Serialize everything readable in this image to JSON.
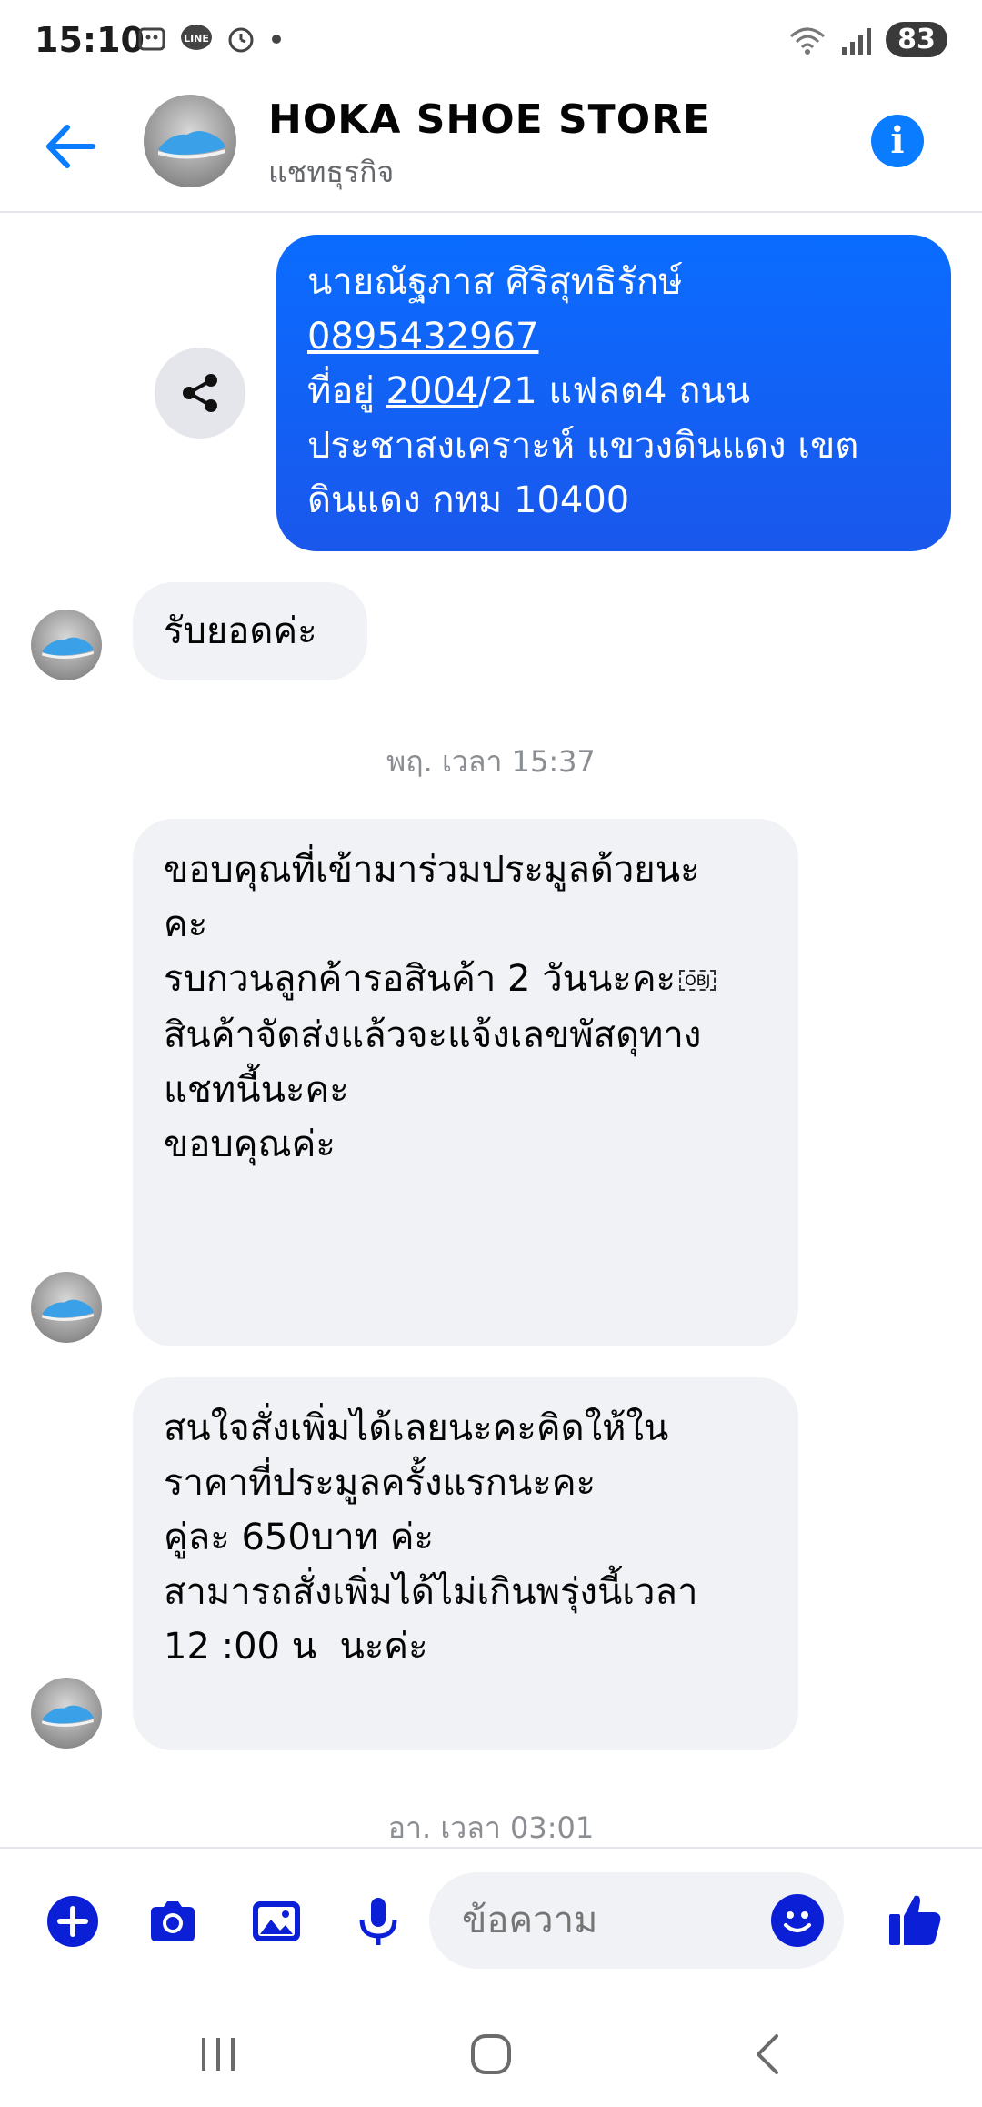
{
  "status_bar": {
    "time": "15:10",
    "icons": [
      "screenshot-icon",
      "line-icon",
      "alarm-icon",
      "dot-icon"
    ],
    "battery": "83"
  },
  "header": {
    "title": "HOKA SHOE STORE",
    "subtitle": "แชทธุรกิจ"
  },
  "messages": {
    "outgoing_1": {
      "lines": [
        "นายณัฐภาส ศิริสุทธิรักษ์",
        "0895432967",
        "ที่อยู่ ",
        "2004",
        "/21 แฟลต4 ถนน",
        "ประชาสงเคราะห์ แขวงดินแดง เขต",
        "ดินแดง กทม 10400"
      ]
    },
    "incoming_1": {
      "text": "รับยอดค่ะ"
    },
    "timestamp_1": "พฤ. เวลา 15:37",
    "incoming_2": {
      "lines": [
        "ขอบคุณที่เข้ามาร่วมประมูลด้วยนะ",
        "คะ",
        "",
        "รบกวนลูกค้ารอสินค้า 2 วันนะคะ",
        "",
        "สินค้าจัดส่งแล้วจะแจ้งเลขพัสดุทาง",
        "แชทนี้นะคะ",
        "",
        "ขอบคุณค่ะ"
      ],
      "obj_glyph": "OBJ"
    },
    "incoming_3": {
      "lines": [
        "สนใจสั่งเพิ่มได้เลยนะคะคิดให้ใน",
        "ราคาที่ประมูลครั้งแรกนะคะ",
        "คู่ละ 650บาท ค่ะ",
        "",
        "สามารถสั่งเพิ่มได้ไม่เกินพรุ่งนี้เวลา",
        "12 :00 น  นะค่ะ"
      ]
    },
    "timestamp_2": "อา. เวลา 03:01"
  },
  "composer": {
    "placeholder": "ข้อความ"
  },
  "colors": {
    "accent": "#0a7cff",
    "outgoing_bubble": "#1a5cff",
    "incoming_bubble": "#f0f2f5",
    "icon_dark": "#0a1fd6"
  }
}
